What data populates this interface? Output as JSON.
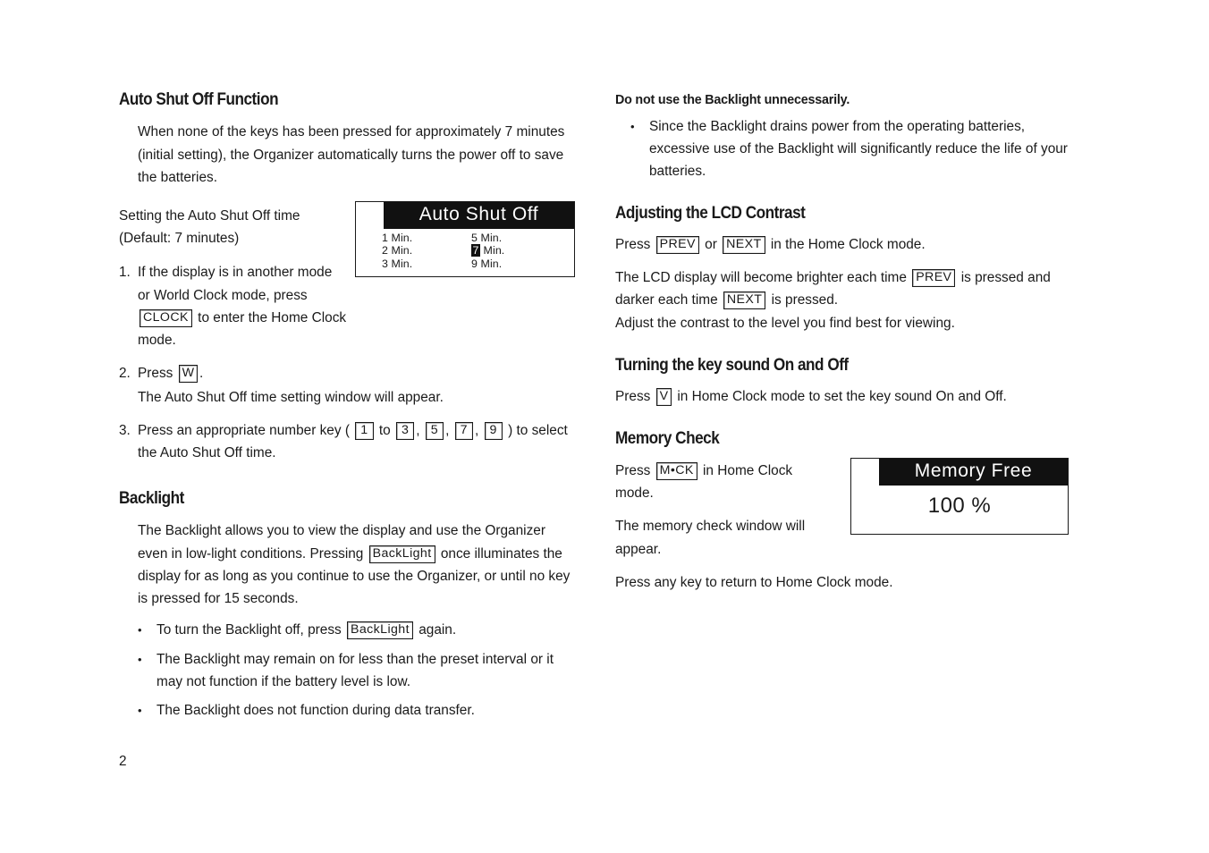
{
  "page": {
    "number": "2"
  },
  "left_column": {
    "section1": {
      "heading": "Auto Shut Off Function",
      "intro": "When none of the keys has been pressed for approximately 7 minutes (initial setting), the Organizer automatically turns the power off to save the batteries.",
      "setting_line1": "Setting the Auto Shut Off time",
      "setting_line2": "(Default: 7 minutes)",
      "steps": [
        {
          "marker": "1.",
          "text_a": "If the display is in another mode or World Clock mode, press ",
          "key": "CLOCK",
          "text_b": " to enter the Home Clock mode."
        },
        {
          "marker": "2.",
          "text_a": "Press ",
          "key": "W",
          "text_b": ".",
          "note": "The Auto Shut Off time setting window will appear."
        },
        {
          "marker": "3.",
          "text_a": "Press an appropriate number key ( ",
          "keys": [
            "1",
            "3",
            "5",
            "7",
            "9"
          ],
          "joiner_to": " to ",
          "joiner_comma": ", ",
          "text_b": " ) to select the Auto Shut Off time."
        }
      ]
    },
    "lcd_auto_shut_off": {
      "title": "Auto Shut Off",
      "column_left": [
        "1 Min.",
        "2 Min.",
        "3 Min."
      ],
      "column_right": [
        {
          "prefix": "",
          "highlight": "",
          "text": "5 Min."
        },
        {
          "prefix": "",
          "highlight": "7",
          "text": " Min."
        },
        {
          "prefix": "",
          "highlight": "",
          "text": "9 Min."
        }
      ]
    },
    "section2": {
      "heading": "Backlight",
      "para_a": "The Backlight allows you to view the display and use the Organizer even in low-light conditions. Pressing ",
      "para_key": "BackLight",
      "para_b": " once illuminates the display for as long as you continue to use the Organizer, or until no key is pressed for 15 seconds.",
      "bullets": [
        {
          "text_a": "To turn the Backlight off, press ",
          "key": "BackLight",
          "text_b": " again."
        },
        {
          "text_a": "The Backlight may remain on for less than the preset interval or it may not function if the battery level is low.",
          "key": "",
          "text_b": ""
        },
        {
          "text_a": "The Backlight does not function during data transfer.",
          "key": "",
          "text_b": ""
        }
      ]
    }
  },
  "right_column": {
    "notice": {
      "heading": "Do not use the Backlight unnecessarily.",
      "bullet": "Since the Backlight drains power from the operating batteries, excessive use of the Backlight will significantly reduce the life of your batteries."
    },
    "section3": {
      "heading": "Adjusting the LCD Contrast",
      "line1_a": "Press ",
      "line1_key1": "PREV",
      "line1_mid": " or ",
      "line1_key2": "NEXT",
      "line1_b": " in the Home Clock mode.",
      "line2_a": "The LCD display will become brighter each time ",
      "line2_key1": "PREV",
      "line2_b": " is pressed and darker each time ",
      "line2_key2": "NEXT",
      "line2_c": " is pressed.",
      "line3": "Adjust the contrast to the level you find best for viewing."
    },
    "section4": {
      "heading": "Turning the key sound On and Off",
      "line_a": "Press ",
      "key": "V",
      "line_b": " in Home Clock mode to set the key sound On and Off."
    },
    "section5": {
      "heading": "Memory Check",
      "line1_a": "Press ",
      "line1_key": "M•CK",
      "line1_b": " in Home Clock mode.",
      "line2": "The memory check window will appear.",
      "line3": "Press any key to return to Home Clock mode."
    },
    "lcd_memory": {
      "title": "Memory Free",
      "value": "100 %"
    }
  },
  "colors": {
    "text": "#1a1a1a",
    "lcd_bar_bg": "#111111",
    "lcd_bar_fg": "#ffffff",
    "page_bg": "#ffffff"
  }
}
